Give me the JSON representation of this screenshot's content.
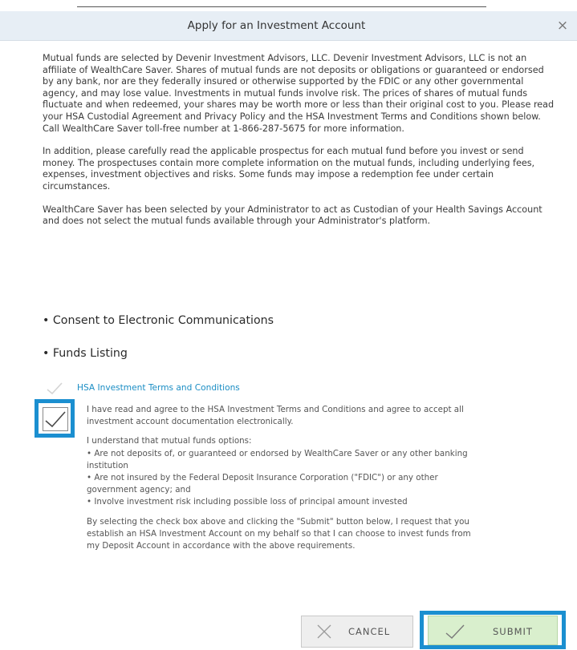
{
  "dialog": {
    "title": "Apply for an Investment Account",
    "close_label": "×",
    "paragraphs": [
      [
        "Mutual funds are selected by Devenir Investment Advisors, LLC. Devenir Investment Advisors, LLC",
        "is not an affiliate of WealthCare Saver. Shares of mutual funds are not deposits or obligations or",
        "guaranteed or endorsed by any bank, nor are they federally insured or otherwise supported by the",
        "FDIC or any other governmental agency, and may lose value. Investments in mutual funds involve",
        "risk. The prices of shares of mutual funds fluctuate and when redeemed, your shares may be worth",
        "more or less than their original cost to you. Please read your HSA Custodial Agreement and",
        "Privacy Policy and the HSA Investment Terms and Conditions shown below. Call WealthCare Saver",
        "toll-free number at 1-866-287-5675 for more information."
      ],
      [
        "In addition, please carefully read the applicable prospectus for each mutual fund before you invest",
        "or send money. The prospectuses contain more complete information on the mutual funds,",
        "including underlying fees, expenses, investment objectives and risks. Some funds may impose a",
        "redemption fee under certain circumstances."
      ],
      [
        "WealthCare Saver has been selected by your Administrator to act as Custodian of your Health",
        "Savings Account and does not select the mutual funds available through your Administrator's",
        "platform."
      ]
    ],
    "links": {
      "consent": "• Consent to Electronic Communications",
      "funds": "• Funds Listing",
      "terms": "HSA Investment Terms and Conditions"
    },
    "agreement": {
      "checked": true,
      "lines": [
        "I have read and agree to the HSA Investment Terms and Conditions and agree to accept all",
        "investment account documentation electronically."
      ]
    },
    "understand": {
      "lines": [
        "I understand that mutual funds options:",
        "• Are not deposits of, or guaranteed or endorsed by WealthCare Saver or any other banking",
        "institution",
        "• Are not insured by the Federal Deposit Insurance Corporation (\"FDIC\") or any other",
        "government agency; and",
        "• Involve investment risk including possible loss of principal amount invested"
      ]
    },
    "request": {
      "lines": [
        "By selecting the check box above and clicking the \"Submit\" button below, I request that you",
        "establish an HSA Investment Account on my behalf so that I can choose to invest funds from",
        "my Deposit Account in accordance with the above requirements."
      ]
    },
    "buttons": {
      "cancel": "CANCEL",
      "submit": "SUBMIT"
    },
    "colors": {
      "highlight": "#1b8fd0",
      "submit_bg": "#d9efcd",
      "link": "#1a8dc4"
    }
  }
}
